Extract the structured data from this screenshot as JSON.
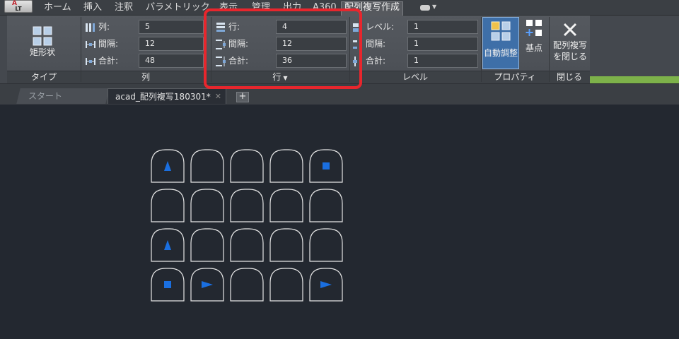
{
  "app": {
    "logo_text": "LT"
  },
  "menu": {
    "tabs": [
      {
        "label": "ホーム",
        "active": false
      },
      {
        "label": "挿入",
        "active": false
      },
      {
        "label": "注釈",
        "active": false
      },
      {
        "label": "パラメトリック",
        "active": false
      },
      {
        "label": "表示",
        "active": false
      },
      {
        "label": "管理",
        "active": false
      },
      {
        "label": "出力",
        "active": false
      },
      {
        "label": "A360",
        "active": false
      },
      {
        "label": "配列複写作成",
        "active": true
      }
    ]
  },
  "ribbon": {
    "type_panel": {
      "button_label": "矩形状",
      "panel_label": "タイプ"
    },
    "column_panel": {
      "panel_label": "列",
      "count_label": "列:",
      "count_value": "5",
      "spacing_label": "間隔:",
      "spacing_value": "12",
      "total_label": "合計:",
      "total_value": "48"
    },
    "row_panel": {
      "panel_label": "行",
      "count_label": "行:",
      "count_value": "4",
      "spacing_label": "間隔:",
      "spacing_value": "12",
      "total_label": "合計:",
      "total_value": "36"
    },
    "level_panel": {
      "panel_label": "レベル",
      "count_label": "レベル:",
      "count_value": "1",
      "spacing_label": "間隔:",
      "spacing_value": "1",
      "total_label": "合計:",
      "total_value": "1"
    },
    "properties_panel": {
      "panel_label": "プロパティ",
      "associative_label": "自動調整",
      "basepoint_label": "基点"
    },
    "close_panel": {
      "panel_label": "閉じる",
      "close_label_line1": "配列複写",
      "close_label_line2": "を閉じる"
    },
    "highlight_color": "#e8262d"
  },
  "doc_tabs": {
    "start_label": "スタート",
    "file_label": "acad_配列複写180301*",
    "new_tab_label": "+"
  },
  "canvas": {
    "background": "#232830",
    "stroke_color": "#e6e6e6",
    "marker_color": "#1a6fe0",
    "grid": {
      "rows": 4,
      "cols": 5,
      "markers": [
        {
          "row": 0,
          "col": 0,
          "shape": "triangle-up"
        },
        {
          "row": 0,
          "col": 4,
          "shape": "square"
        },
        {
          "row": 2,
          "col": 0,
          "shape": "triangle-up"
        },
        {
          "row": 3,
          "col": 0,
          "shape": "square"
        },
        {
          "row": 3,
          "col": 1,
          "shape": "triangle-right"
        },
        {
          "row": 3,
          "col": 4,
          "shape": "triangle-right"
        }
      ]
    }
  }
}
